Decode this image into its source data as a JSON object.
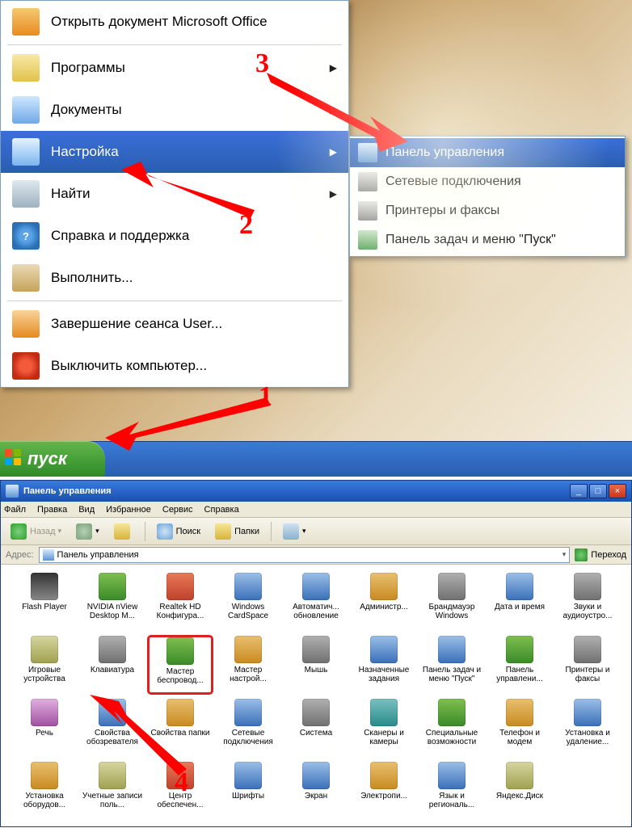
{
  "annotations": {
    "n1": "1",
    "n2": "2",
    "n3": "3",
    "n4": "4"
  },
  "start_button": {
    "label": "пуск"
  },
  "start_menu": {
    "items": [
      {
        "label": "Открыть документ Microsoft Office",
        "has_arrow": false,
        "icon": "ic-office"
      },
      {
        "label": "Программы",
        "has_arrow": true,
        "icon": "ic-progs"
      },
      {
        "label": "Документы",
        "has_arrow": true,
        "icon": "ic-docs"
      },
      {
        "label": "Настройка",
        "has_arrow": true,
        "icon": "ic-settings",
        "selected": true
      },
      {
        "label": "Найти",
        "has_arrow": true,
        "icon": "ic-find"
      },
      {
        "label": "Справка и поддержка",
        "has_arrow": false,
        "icon": "ic-help"
      },
      {
        "label": "Выполнить...",
        "has_arrow": false,
        "icon": "ic-run"
      },
      {
        "label": "Завершение сеанса User...",
        "has_arrow": false,
        "icon": "ic-logoff"
      },
      {
        "label": "Выключить компьютер...",
        "has_arrow": false,
        "icon": "ic-shutdown"
      }
    ]
  },
  "submenu": {
    "items": [
      {
        "label": "Панель управления",
        "icon": "ic-cpanel",
        "selected": true
      },
      {
        "label": "Сетевые подключения",
        "icon": "ic-net"
      },
      {
        "label": "Принтеры и факсы",
        "icon": "ic-print"
      },
      {
        "label": "Панель задач и меню \"Пуск\"",
        "icon": "ic-tbar"
      }
    ]
  },
  "window": {
    "title": "Панель управления",
    "menus": {
      "file": "Файл",
      "edit": "Правка",
      "view": "Вид",
      "fav": "Избранное",
      "tools": "Сервис",
      "help": "Справка"
    },
    "toolbar": {
      "back": "Назад",
      "search": "Поиск",
      "folders": "Папки"
    },
    "addressbar": {
      "label": "Адрес:",
      "value": "Панель управления",
      "go": "Переход"
    }
  },
  "control_panel_items": [
    {
      "label": "Flash Player",
      "t": "t0"
    },
    {
      "label": "NVIDIA nView Desktop M...",
      "t": "t1"
    },
    {
      "label": "Realtek HD Конфигура...",
      "t": "t5"
    },
    {
      "label": "Windows CardSpace",
      "t": "t2"
    },
    {
      "label": "Автоматич... обновление",
      "t": "t2"
    },
    {
      "label": "Администр...",
      "t": "t3"
    },
    {
      "label": "Брандмауэр Windows",
      "t": "t4"
    },
    {
      "label": "Дата и время",
      "t": "t2"
    },
    {
      "label": "Звуки и аудиоустро...",
      "t": "t4"
    },
    {
      "label": "Игровые устройства",
      "t": "t6"
    },
    {
      "label": "Клавиатура",
      "t": "t4"
    },
    {
      "label": "Мастер беспровод...",
      "t": "t1",
      "highlight": true
    },
    {
      "label": "Мастер настрой...",
      "t": "t3"
    },
    {
      "label": "Мышь",
      "t": "t4"
    },
    {
      "label": "Назначенные задания",
      "t": "t2"
    },
    {
      "label": "Панель задач и меню \"Пуск\"",
      "t": "t2"
    },
    {
      "label": "Панель управлени...",
      "t": "t1"
    },
    {
      "label": "Принтеры и факсы",
      "t": "t4"
    },
    {
      "label": "Речь",
      "t": "t8"
    },
    {
      "label": "Свойства обозревателя",
      "t": "t2"
    },
    {
      "label": "Свойства папки",
      "t": "t3"
    },
    {
      "label": "Сетевые подключения",
      "t": "t2"
    },
    {
      "label": "Система",
      "t": "t4"
    },
    {
      "label": "Сканеры и камеры",
      "t": "t7"
    },
    {
      "label": "Специальные возможности",
      "t": "t1"
    },
    {
      "label": "Телефон и модем",
      "t": "t3"
    },
    {
      "label": "Установка и удаление...",
      "t": "t2"
    },
    {
      "label": "Установка оборудов...",
      "t": "t3"
    },
    {
      "label": "Учетные записи поль...",
      "t": "t6"
    },
    {
      "label": "Центр обеспечен...",
      "t": "t5"
    },
    {
      "label": "Шрифты",
      "t": "t2"
    },
    {
      "label": "Экран",
      "t": "t2"
    },
    {
      "label": "Электропи...",
      "t": "t3"
    },
    {
      "label": "Язык и региональ...",
      "t": "t2"
    },
    {
      "label": "Яндекс.Диск",
      "t": "t6"
    }
  ]
}
